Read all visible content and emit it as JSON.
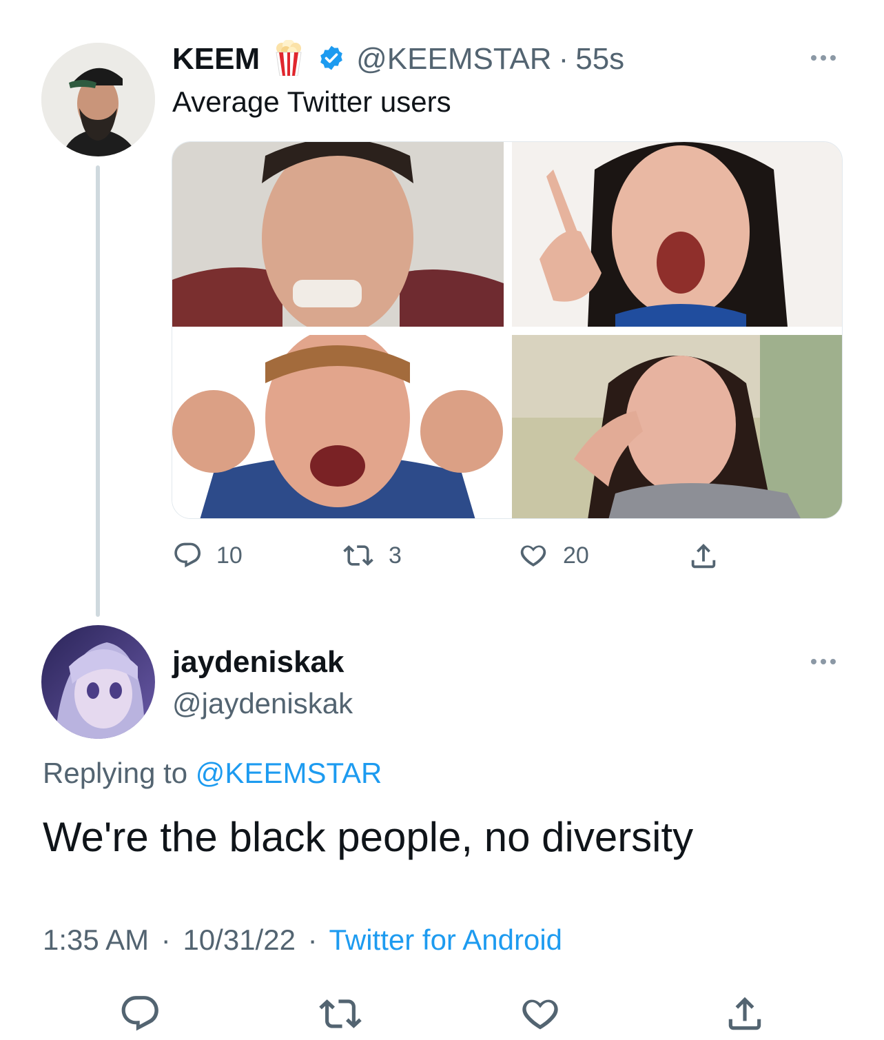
{
  "tweet": {
    "display_name": "KEEM",
    "emoji": "popcorn",
    "verified": true,
    "handle": "@KEEMSTAR",
    "separator": "·",
    "age": "55s",
    "text": "Average Twitter users",
    "counts": {
      "replies": "10",
      "retweets": "3",
      "likes": "20"
    }
  },
  "reply": {
    "display_name": "jaydeniskak",
    "handle": "@jaydeniskak",
    "replying_prefix": "Replying to",
    "replying_to": "@KEEMSTAR",
    "text": "We're the black people, no diversity",
    "time": "1:35 AM",
    "sep1": "·",
    "date": "10/31/22",
    "sep2": "·",
    "source": "Twitter for Android"
  },
  "colors": {
    "accent": "#1d9bf0",
    "muted": "#536471",
    "verified": "#1d9bf0",
    "thread_line": "#cfd9de"
  },
  "icons": [
    "reply-icon",
    "retweet-icon",
    "like-icon",
    "share-icon",
    "more-icon",
    "verified-badge-icon",
    "popcorn-icon"
  ]
}
